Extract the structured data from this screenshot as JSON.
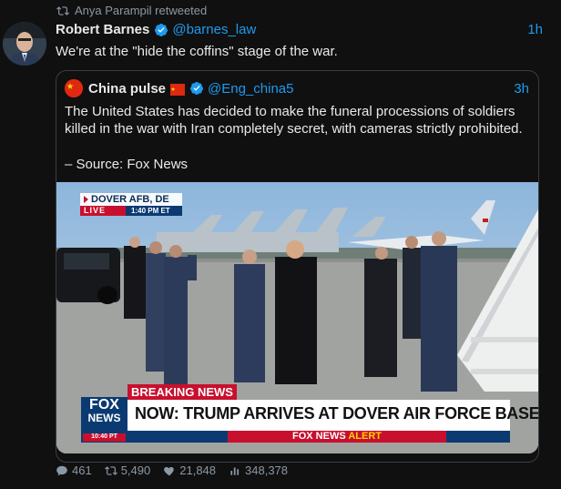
{
  "retweet": {
    "text": "Anya Parampil retweeted"
  },
  "tweet": {
    "name": "Robert Barnes",
    "handle": "@barnes_law",
    "time": "1h",
    "text": "We're at the \"hide the coffins\" stage of the war."
  },
  "quote": {
    "name": "China pulse",
    "handle": "@Eng_china5",
    "time": "3h",
    "text": "The United States has decided to make the funeral processions of soldiers killed in the war with Iran completely secret, with cameras strictly prohibited.",
    "source": "– Source: Fox News"
  },
  "media": {
    "location": "DOVER AFB, DE",
    "live_label": "LIVE",
    "live_time": "1:40 PM ET",
    "breaking_label": "BREAKING NEWS",
    "headline": "NOW: TRUMP ARRIVES AT DOVER AIR FORCE BASE",
    "logo_line1": "FOX",
    "logo_line2": "NEWS",
    "logo_time": "10:40 PT",
    "alert_left": "FOX NEWS",
    "alert_right": "ALERT"
  },
  "stats": {
    "replies": "461",
    "retweets": "5,490",
    "likes": "21,848",
    "views": "348,378"
  },
  "colors": {
    "link": "#1d9bf0",
    "muted": "#8b98a5",
    "fox_red": "#c8102e",
    "fox_blue": "#0b3a73"
  }
}
